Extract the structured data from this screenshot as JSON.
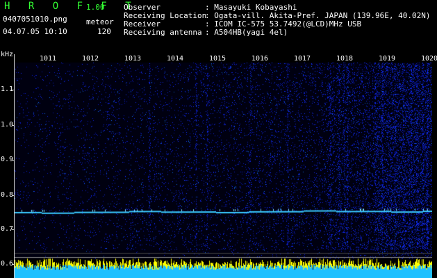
{
  "app": {
    "logo": "H R O F F T",
    "version": "1.00"
  },
  "file": {
    "name": "0407051010.png",
    "datetime": "04.07.05 10:10"
  },
  "meteor": {
    "label": "meteor",
    "count": "120"
  },
  "info": [
    {
      "key": "Observer",
      "value": ": Masayuki Kobayashi"
    },
    {
      "key": "Receiving Location",
      "value": ": Ogata-vill. Akita-Pref. JAPAN (139.96E, 40.02N)"
    },
    {
      "key": "Receiver",
      "value": ": ICOM IC-575 53.7492(@LCD)MHz USB"
    },
    {
      "key": "Receiving antenna",
      "value": ": A504HB(yagi 4el)"
    }
  ],
  "axes": {
    "y_unit": "kHz",
    "y_ticks": [
      "1.1",
      "1.0",
      "0.9",
      "0.8",
      "0.7",
      "0.6"
    ],
    "x_ticks": [
      "1011",
      "1012",
      "1013",
      "1014",
      "1015",
      "1016",
      "1017",
      "1018",
      "1019",
      "1020"
    ]
  },
  "colors": {
    "background": "#000010",
    "noise": "#1f3fbf",
    "carrier": "#39c9ff",
    "level_low": "#20c0ff",
    "level_high": "#ffff00"
  }
}
